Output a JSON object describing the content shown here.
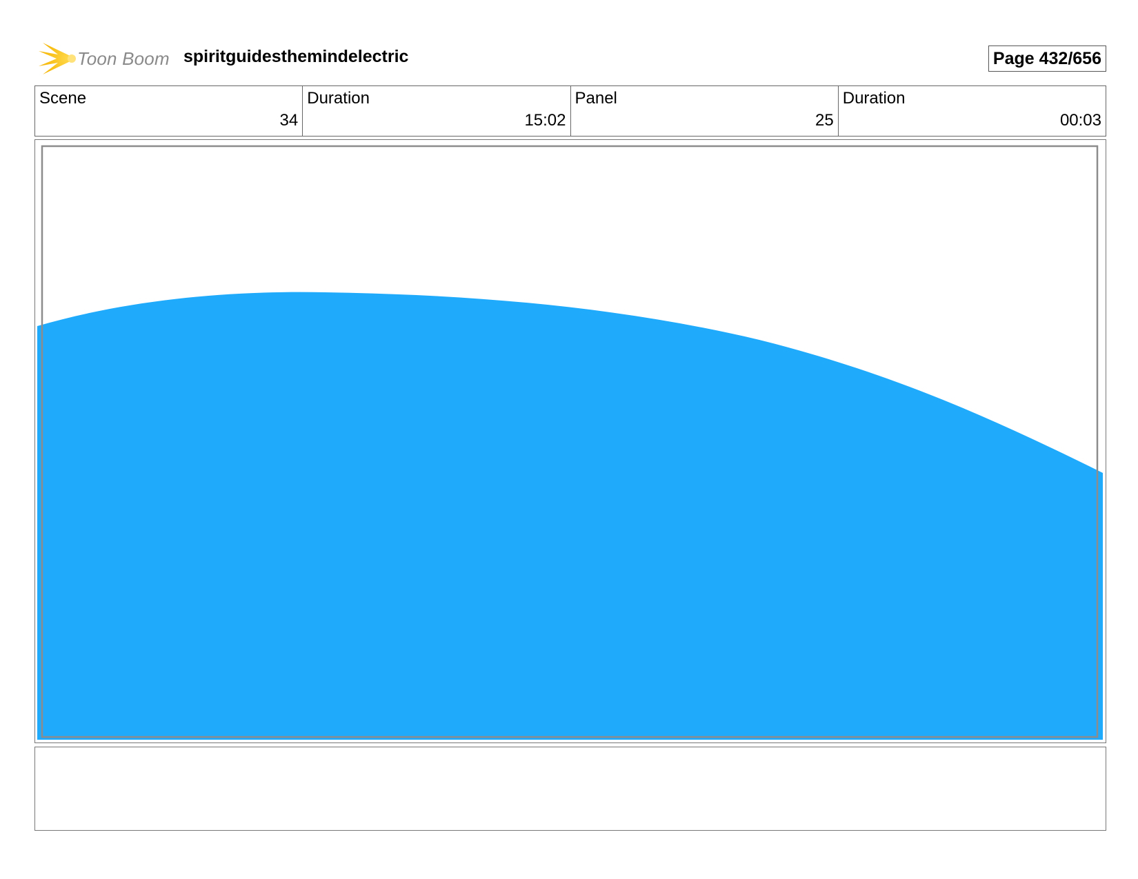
{
  "header": {
    "brand_text": "Toon Boom",
    "project_title": "spiritguidesthemindelectric",
    "page_label": "Page 432/656"
  },
  "info": {
    "scene_label": "Scene",
    "scene_value": "34",
    "scene_duration_label": "Duration",
    "scene_duration_value": "15:02",
    "panel_label": "Panel",
    "panel_value": "25",
    "panel_duration_label": "Duration",
    "panel_duration_value": "00:03"
  },
  "panel": {
    "drawing_color": "#1faafc",
    "frame_color": "#8c8c8c"
  },
  "notes": {}
}
